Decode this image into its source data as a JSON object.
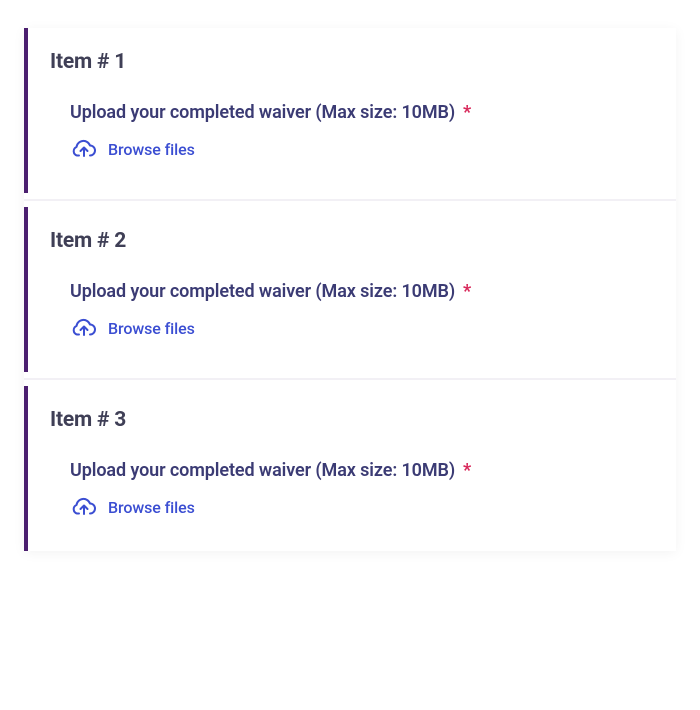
{
  "required_marker": "*",
  "items": [
    {
      "title": "Item # 1",
      "upload_label": "Upload your completed waiver (Max size: 10MB)",
      "browse_label": "Browse files"
    },
    {
      "title": "Item # 2",
      "upload_label": "Upload your completed waiver (Max size: 10MB)",
      "browse_label": "Browse files"
    },
    {
      "title": "Item # 3",
      "upload_label": "Upload your completed waiver (Max size: 10MB)",
      "browse_label": "Browse files"
    }
  ]
}
